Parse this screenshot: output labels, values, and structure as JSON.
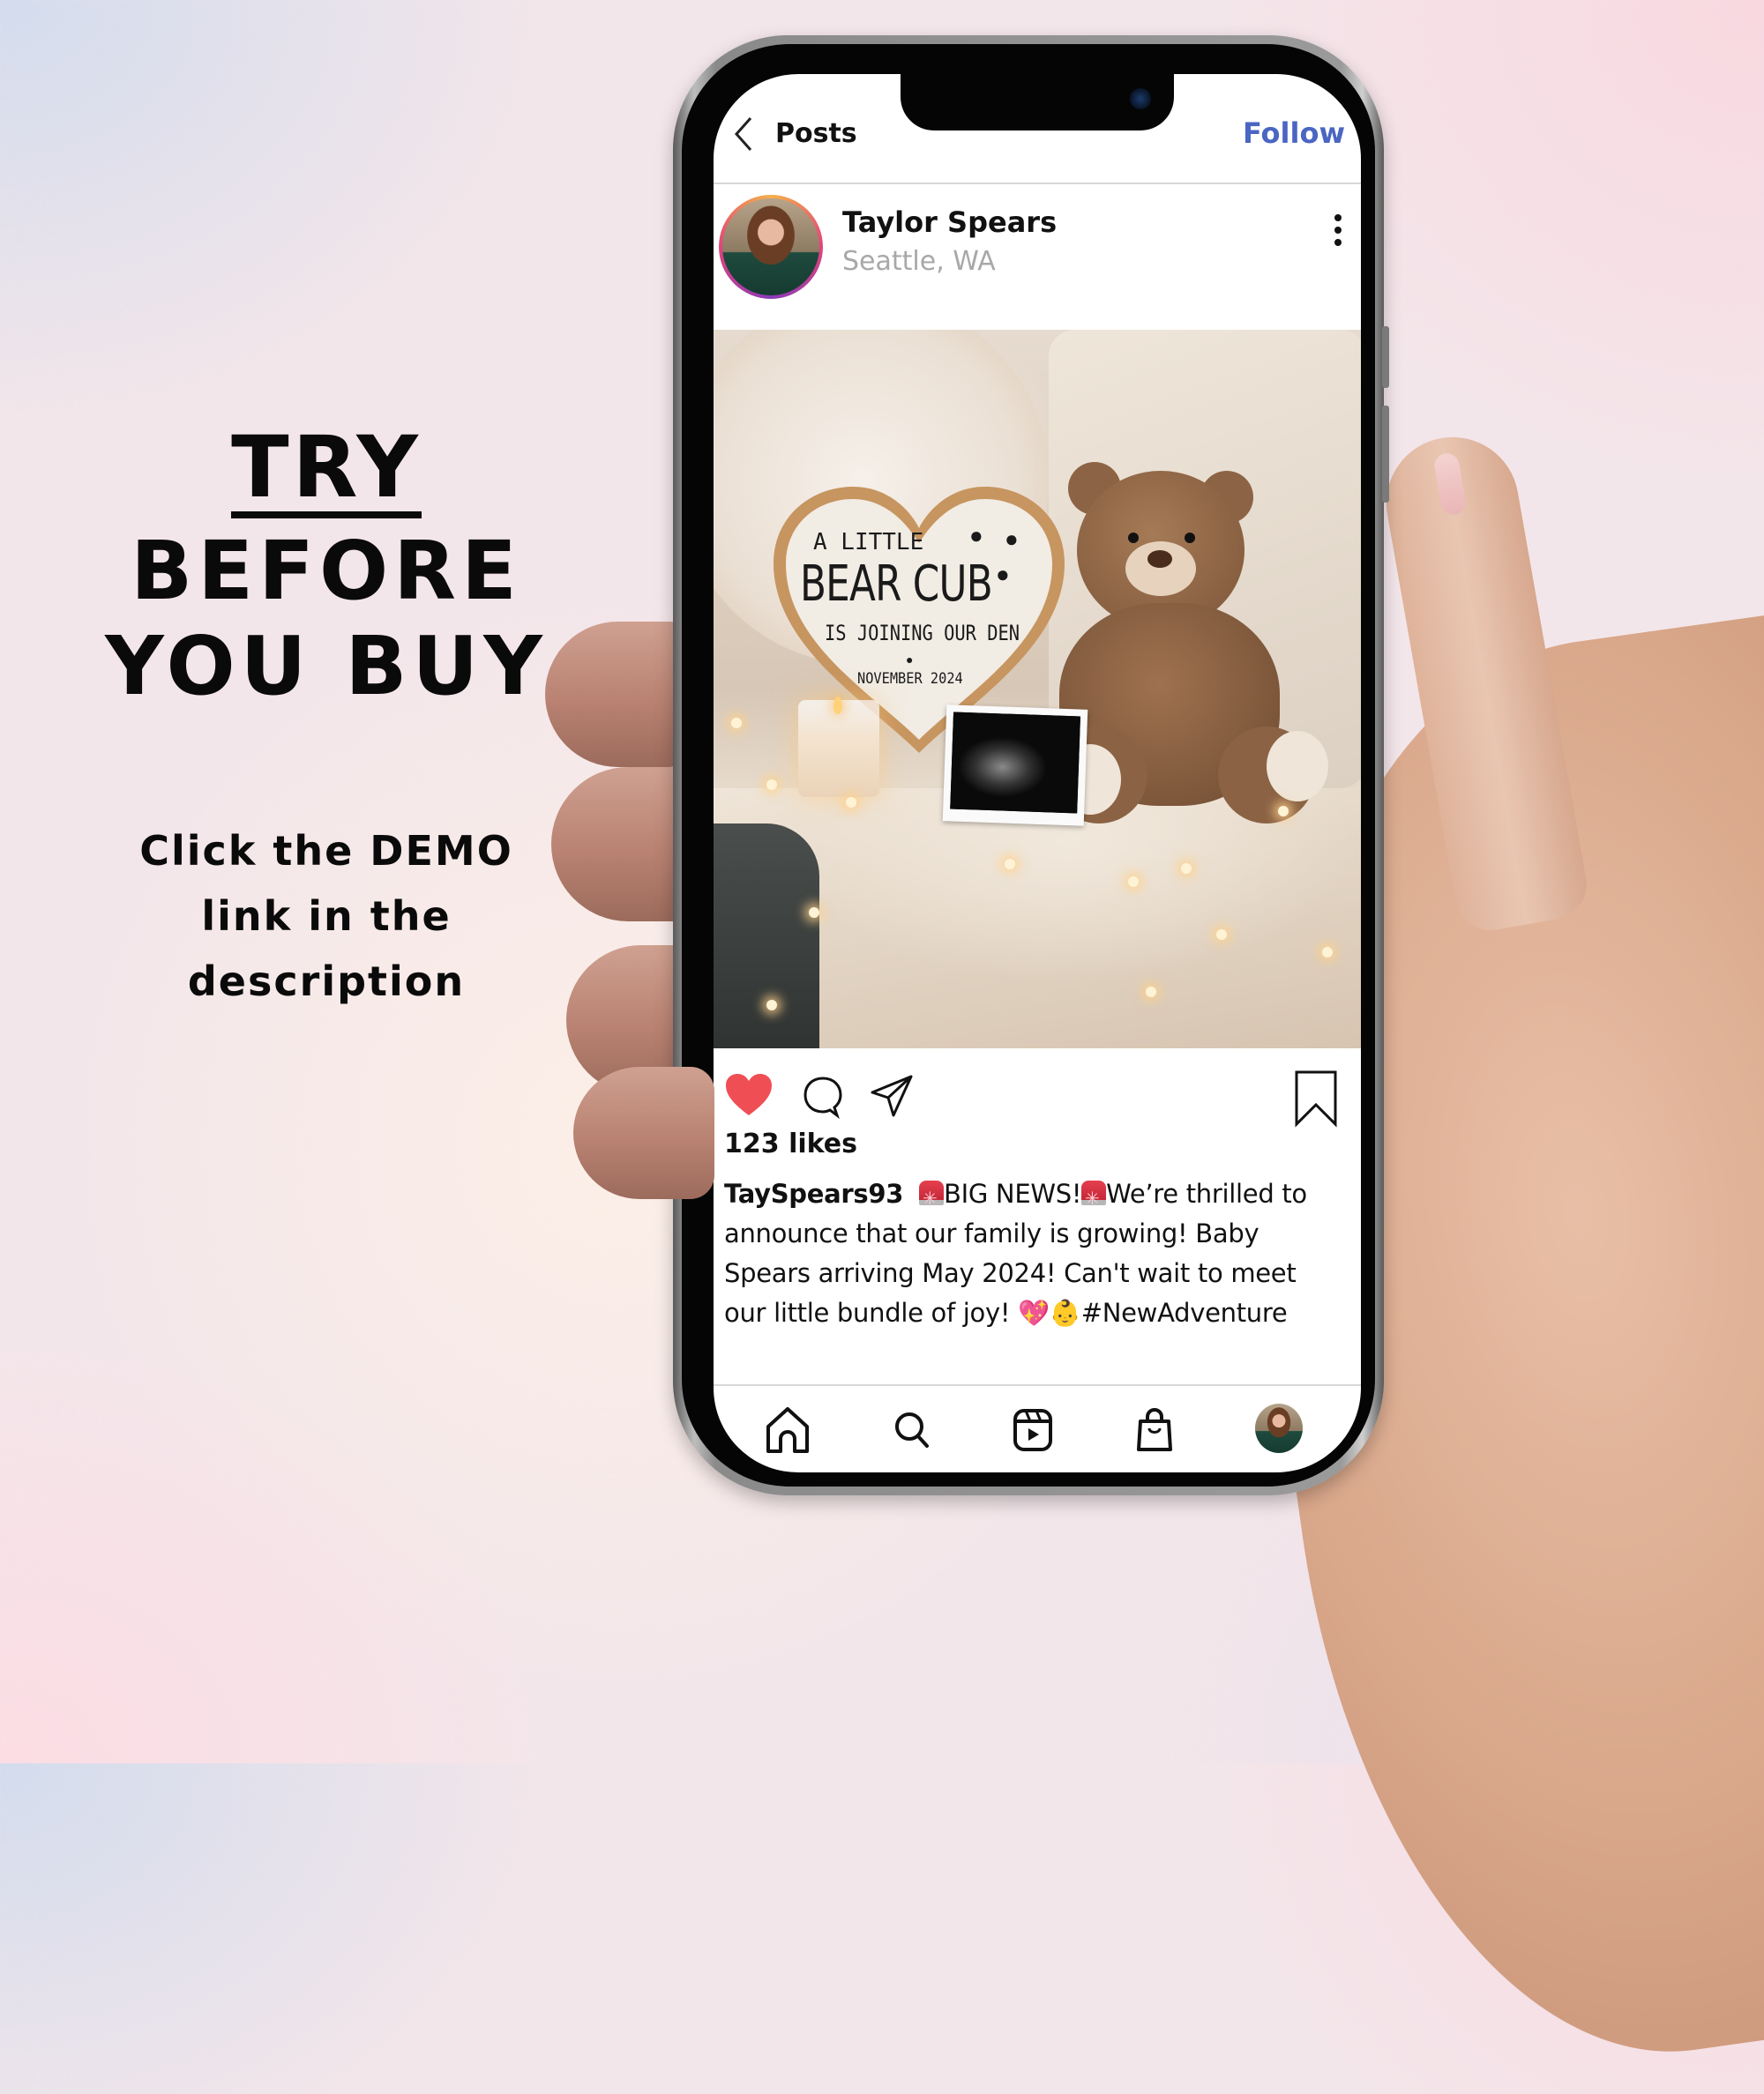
{
  "promo": {
    "headline_try": "TRY",
    "headline_line2": "BEFORE",
    "headline_line3": "YOU BUY",
    "sub_lines": [
      "Click the DEMO",
      "link in the",
      "description"
    ]
  },
  "app": {
    "topbar": {
      "back_icon": "chevron-left-icon",
      "title": "Posts",
      "follow_label": "Follow",
      "follow_color": "#4a66c2"
    },
    "post": {
      "user_name": "Taylor Spears",
      "location": "Seattle, WA",
      "more_icon": "more-vertical-icon",
      "image": {
        "sign_line1": "A LITTLE",
        "sign_line2": "BEAR CUB",
        "sign_line3": "IS JOINING OUR DEN",
        "sign_line4": "NOVEMBER 2024",
        "paw_glyph": "🐾"
      },
      "actions": {
        "like_icon": "heart-filled-icon",
        "like_color": "#f04e55",
        "comment_icon": "comment-icon",
        "share_icon": "send-icon",
        "save_icon": "bookmark-icon"
      },
      "likes": "123 likes",
      "caption": {
        "username": "TaySpears93",
        "part1": "BIG NEWS!",
        "part2": "We’re thrilled to announce that our family is growing! Baby Spears arriving May 2024! Can't wait to meet our little bundle of joy! ",
        "emojis": "💖👶",
        "hashtag": "#NewAdventure"
      }
    },
    "bottom_nav": [
      {
        "icon": "home-icon"
      },
      {
        "icon": "search-icon"
      },
      {
        "icon": "reels-icon"
      },
      {
        "icon": "shop-bag-icon"
      },
      {
        "icon": "profile-avatar"
      }
    ]
  }
}
